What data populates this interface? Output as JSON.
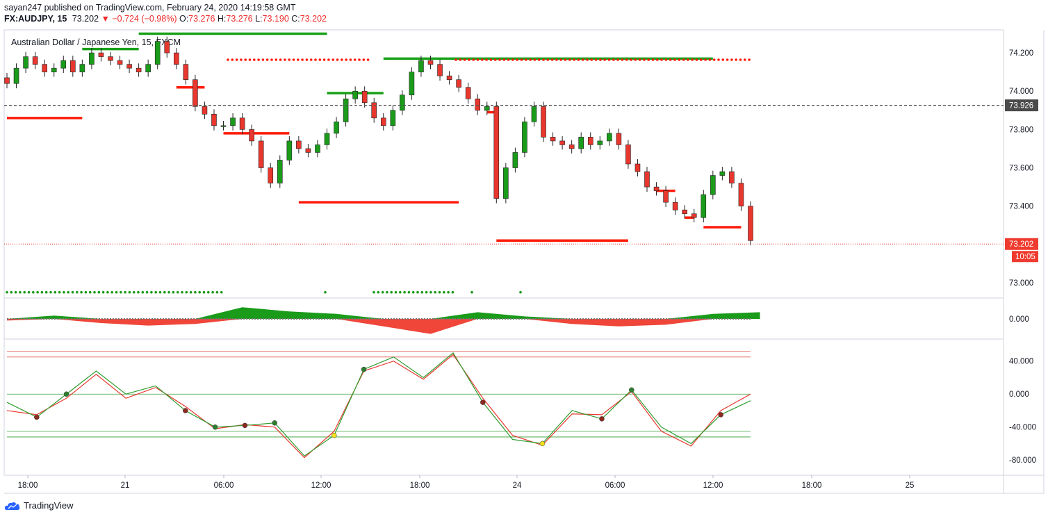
{
  "header": {
    "line1": "sayan247 published on TradingView.com, February 24, 2020 14:19:58 GMT",
    "symbol": "FX:AUDJPY, 15",
    "last": "73.202",
    "change": "▼ −0.724 (−0.98%)",
    "o_label": "O:",
    "o_value": "73.276",
    "h_label": "H:",
    "h_value": "73.276",
    "l_label": "L:",
    "l_value": "73.190",
    "c_label": "C:",
    "c_value": "73.202"
  },
  "legend": {
    "title": "Australian Dollar / Japanese Yen, 15, FXCM"
  },
  "price_axis": {
    "ticks": [
      "74.200",
      "74.000",
      "73.800",
      "73.600",
      "73.400",
      "73.000"
    ],
    "level_label": "73.926",
    "last_label": "73.202",
    "countdown": "10:05"
  },
  "osc1_axis": {
    "ticks": [
      "0.000"
    ]
  },
  "osc2_axis": {
    "ticks": [
      "40.000",
      "0.000",
      "-40.000",
      "-80.000"
    ]
  },
  "time_axis": {
    "ticks": [
      "18:00",
      "21",
      "06:00",
      "12:00",
      "18:00",
      "24",
      "06:00",
      "12:00",
      "18:00",
      "25"
    ]
  },
  "footer": {
    "brand": "TradingView"
  },
  "colors": {
    "up": "#1a9b1a",
    "down": "#e8372e",
    "resistance": "#ff1a0a",
    "support": "#18a018",
    "level": "#555555"
  },
  "chart_data": {
    "type": "candlestick",
    "title": "Australian Dollar / Japanese Yen, 15, FXCM",
    "ylim": [
      72.92,
      74.32
    ],
    "key_level": 73.926,
    "last_price": 73.202,
    "series": [
      {
        "name": "price_close",
        "values": [
          74.04,
          74.12,
          74.18,
          74.14,
          74.1,
          74.12,
          74.16,
          74.1,
          74.14,
          74.2,
          74.18,
          74.16,
          74.14,
          74.12,
          74.1,
          74.14,
          74.26,
          74.2,
          74.14,
          74.06,
          73.92,
          73.88,
          73.82,
          73.82,
          73.86,
          73.8,
          73.74,
          73.6,
          73.52,
          73.64,
          73.74,
          73.7,
          73.68,
          73.72,
          73.78,
          73.84,
          73.96,
          74.0,
          73.94,
          73.86,
          73.82,
          73.9,
          73.98,
          74.1,
          74.16,
          74.14,
          74.08,
          74.06,
          74.02,
          73.96,
          73.9,
          73.92,
          73.44,
          73.6,
          73.68,
          73.84,
          73.92,
          73.76,
          73.74,
          73.72,
          73.7,
          73.76,
          73.72,
          73.74,
          73.78,
          73.72,
          73.62,
          73.58,
          73.5,
          73.48,
          73.42,
          73.38,
          73.36,
          73.34,
          73.46,
          73.56,
          73.58,
          73.52,
          73.4,
          73.22
        ]
      },
      {
        "name": "support_dots",
        "values": [
          72.95,
          72.95,
          72.95,
          72.95,
          72.95,
          72.95
        ]
      }
    ],
    "levels": {
      "resistance": [
        [
          0,
          8,
          73.86
        ],
        [
          18,
          21,
          74.02
        ],
        [
          23,
          30,
          73.78
        ],
        [
          31,
          48,
          73.42
        ],
        [
          51,
          52,
          73.89
        ],
        [
          52,
          66,
          73.22
        ],
        [
          69,
          71,
          73.48
        ],
        [
          72,
          73,
          73.34
        ],
        [
          74,
          78,
          73.29
        ]
      ],
      "support": [
        [
          8,
          14,
          74.22
        ],
        [
          14,
          34,
          74.3
        ],
        [
          34,
          40,
          73.99
        ],
        [
          40,
          75,
          74.17
        ]
      ]
    },
    "oscillator_1": {
      "name": "momentum histogram",
      "x": [
        0,
        5,
        10,
        15,
        20,
        25,
        30,
        35,
        40,
        45,
        50,
        55,
        60,
        65,
        70,
        75,
        80
      ],
      "values": [
        -0.2,
        0.4,
        -0.5,
        -0.8,
        -0.6,
        1.4,
        0.9,
        0.6,
        -0.9,
        -1.8,
        0.8,
        0.3,
        -0.6,
        -0.9,
        -0.7,
        0.6,
        0.8
      ]
    },
    "oscillator_2": {
      "name": "stochastic-type oscillator",
      "ylim": [
        -95,
        60
      ],
      "levels": [
        52,
        45,
        0,
        -45,
        -52
      ],
      "fast": [
        -10,
        -28,
        0,
        28,
        0,
        10,
        -20,
        -40,
        -38,
        -35,
        -75,
        -50,
        30,
        45,
        20,
        50,
        -10,
        -55,
        -60,
        -20,
        -30,
        5,
        -40,
        -60,
        -25,
        -8
      ],
      "slow": [
        -20,
        -25,
        -5,
        24,
        -5,
        8,
        -15,
        -42,
        -37,
        -40,
        -77,
        -45,
        28,
        40,
        18,
        48,
        -5,
        -50,
        -62,
        -24,
        -25,
        3,
        -45,
        -63,
        -20,
        0
      ]
    }
  }
}
